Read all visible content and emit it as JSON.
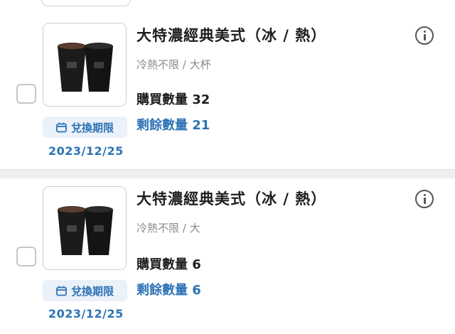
{
  "products": [
    {
      "title": "大特濃經典美式（冰 / 熱）",
      "subtitle": "冷熱不限 / 大杯",
      "purchase_text": "購買數量 32",
      "remain_text": "剩餘數量 21",
      "redeem_label": "兌換期限",
      "expiry_date": "2023/12/25",
      "info_icon": "info-icon",
      "calendar_icon": "calendar-icon"
    },
    {
      "title": "大特濃經典美式（冰 / 熱）",
      "subtitle": "冷熱不限 / 大",
      "purchase_text": "購買數量 6",
      "remain_text": "剩餘數量 6",
      "redeem_label": "兌換期限",
      "expiry_date": "2023/12/25",
      "info_icon": "info-icon",
      "calendar_icon": "calendar-icon"
    }
  ],
  "colors": {
    "accent": "#2d73b5",
    "badge_bg": "#eaf1f8",
    "separator": "#eeeeee"
  }
}
